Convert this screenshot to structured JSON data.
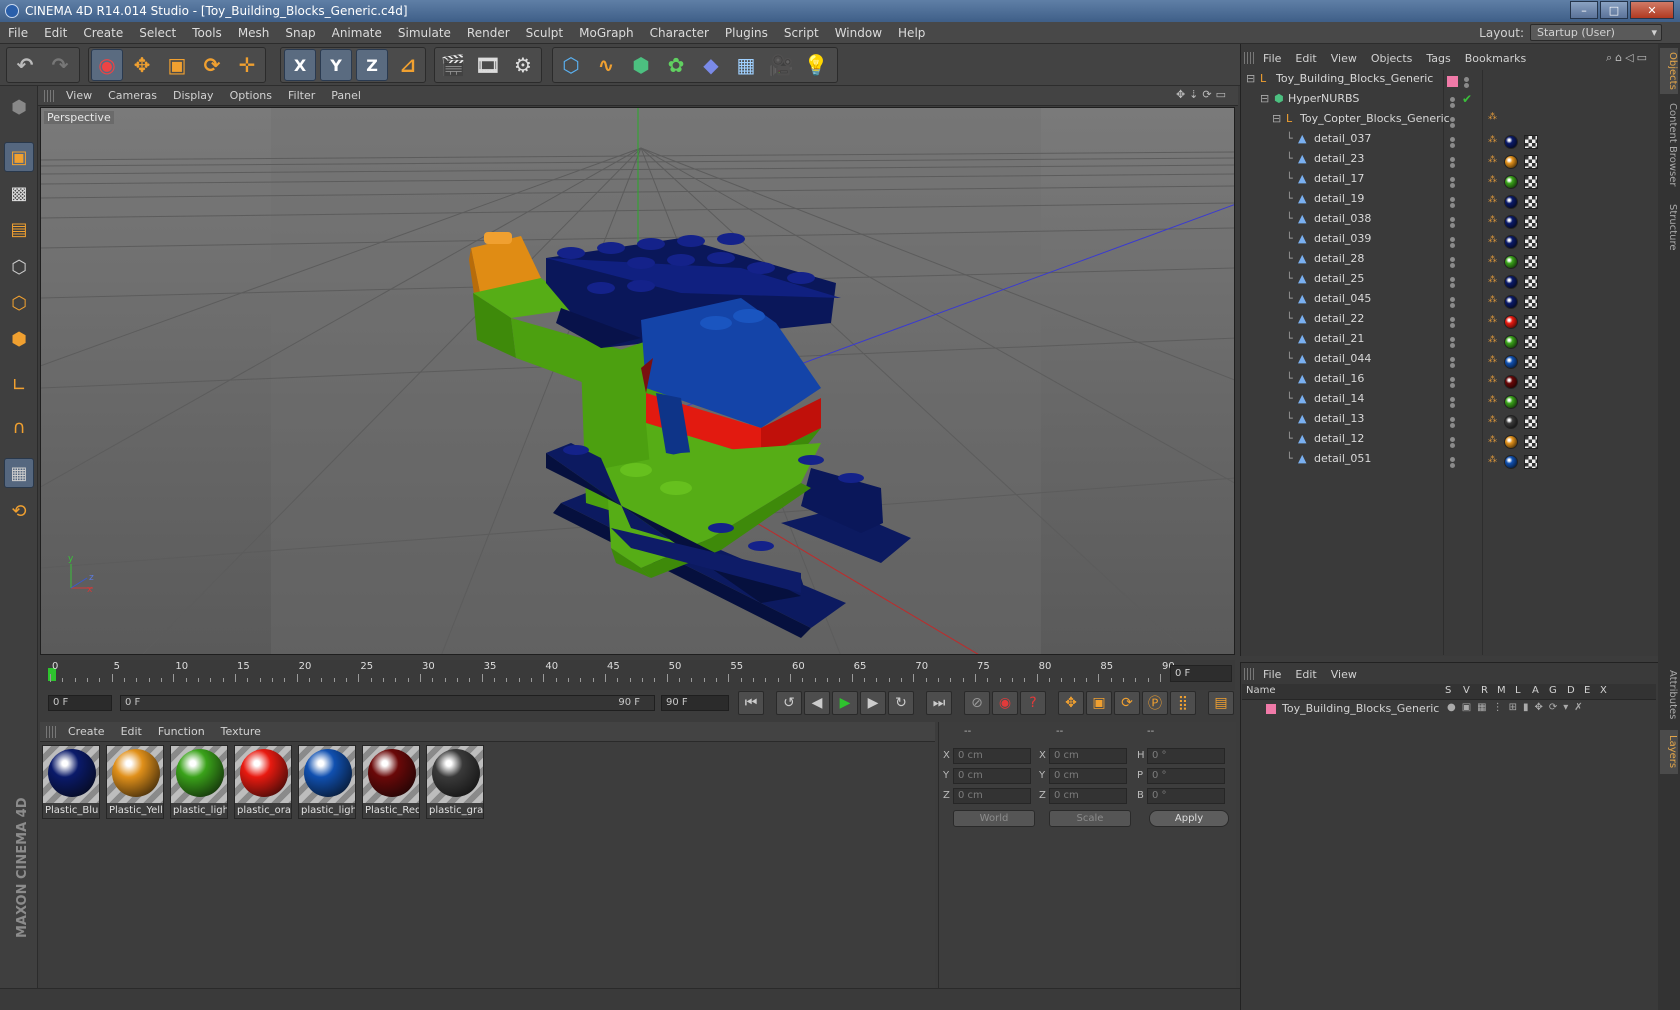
{
  "window": {
    "title": "CINEMA 4D R14.014 Studio - [Toy_Building_Blocks_Generic.c4d]",
    "minimize": "–",
    "maximize": "□",
    "close": "✕"
  },
  "menubar": [
    "File",
    "Edit",
    "Create",
    "Select",
    "Tools",
    "Mesh",
    "Snap",
    "Animate",
    "Simulate",
    "Render",
    "Sculpt",
    "MoGraph",
    "Character",
    "Plugins",
    "Script",
    "Window",
    "Help"
  ],
  "layout": {
    "label": "Layout:",
    "value": "Startup (User)"
  },
  "toolbar": {
    "x_label": "X",
    "y_label": "Y",
    "z_label": "Z"
  },
  "viewport": {
    "menu": [
      "View",
      "Cameras",
      "Display",
      "Options",
      "Filter",
      "Panel"
    ],
    "camera_label": "Perspective",
    "axis_y": "y",
    "axis_x": "x",
    "axis_z": "z"
  },
  "timeline": {
    "ticks": [
      "0",
      "5",
      "10",
      "15",
      "20",
      "25",
      "30",
      "35",
      "40",
      "45",
      "50",
      "55",
      "60",
      "65",
      "70",
      "75",
      "80",
      "85",
      "90"
    ],
    "current_frame": "0 F"
  },
  "transport": {
    "start_field": "0 F",
    "range_start": "0 F",
    "range_end": "90 F",
    "end_field": "90 F"
  },
  "materials": {
    "menu": [
      "Create",
      "Edit",
      "Function",
      "Texture"
    ],
    "items": [
      {
        "label": "Plastic_Blu",
        "color": "#0a1a6a"
      },
      {
        "label": "Plastic_Yell",
        "color": "#e0901a"
      },
      {
        "label": "plastic_ligh",
        "color": "#3aa21a"
      },
      {
        "label": "plastic_ora",
        "color": "#e81a10"
      },
      {
        "label": "plastic_ligh",
        "color": "#1050b0"
      },
      {
        "label": "Plastic_Red",
        "color": "#6a0808"
      },
      {
        "label": "plastic_gra",
        "color": "#3a3a3a"
      }
    ]
  },
  "coordinates": {
    "headers": [
      "--",
      "--",
      "--"
    ],
    "rows": [
      {
        "a": "X",
        "av": "0 cm",
        "b": "X",
        "bv": "0 cm",
        "c": "H",
        "cv": "0 °"
      },
      {
        "a": "Y",
        "av": "0 cm",
        "b": "Y",
        "bv": "0 cm",
        "c": "P",
        "cv": "0 °"
      },
      {
        "a": "Z",
        "av": "0 cm",
        "b": "Z",
        "bv": "0 cm",
        "c": "B",
        "cv": "0 °"
      }
    ],
    "world": "World",
    "scale": "Scale",
    "apply": "Apply"
  },
  "objects": {
    "menu": [
      "File",
      "Edit",
      "View",
      "Objects",
      "Tags",
      "Bookmarks"
    ],
    "root": "Toy_Building_Blocks_Generic",
    "nurbs": "HyperNURBS",
    "group": "Toy_Copter_Blocks_Generic",
    "items": [
      {
        "name": "detail_037",
        "color": "#0a1a6a"
      },
      {
        "name": "detail_23",
        "color": "#e0901a"
      },
      {
        "name": "detail_17",
        "color": "#3aa21a"
      },
      {
        "name": "detail_19",
        "color": "#0a1a6a"
      },
      {
        "name": "detail_038",
        "color": "#0a1a6a"
      },
      {
        "name": "detail_039",
        "color": "#0a1a6a"
      },
      {
        "name": "detail_28",
        "color": "#3aa21a"
      },
      {
        "name": "detail_25",
        "color": "#0a1a6a"
      },
      {
        "name": "detail_045",
        "color": "#0a1a6a"
      },
      {
        "name": "detail_22",
        "color": "#e81a10"
      },
      {
        "name": "detail_21",
        "color": "#3aa21a"
      },
      {
        "name": "detail_044",
        "color": "#1050b0"
      },
      {
        "name": "detail_16",
        "color": "#6a0808"
      },
      {
        "name": "detail_14",
        "color": "#3aa21a"
      },
      {
        "name": "detail_13",
        "color": "#3a3a3a"
      },
      {
        "name": "detail_12",
        "color": "#e0901a"
      },
      {
        "name": "detail_051",
        "color": "#1050b0"
      }
    ]
  },
  "layers": {
    "menu": [
      "File",
      "Edit",
      "View"
    ],
    "columns": [
      "Name",
      "S",
      "V",
      "R",
      "M",
      "L",
      "A",
      "G",
      "D",
      "E",
      "X"
    ],
    "row": "Toy_Building_Blocks_Generic"
  },
  "side_tabs": [
    "Objects",
    "Content Browser",
    "Structure",
    "Attributes",
    "Layers"
  ],
  "brand": "MAXON CINEMA 4D"
}
